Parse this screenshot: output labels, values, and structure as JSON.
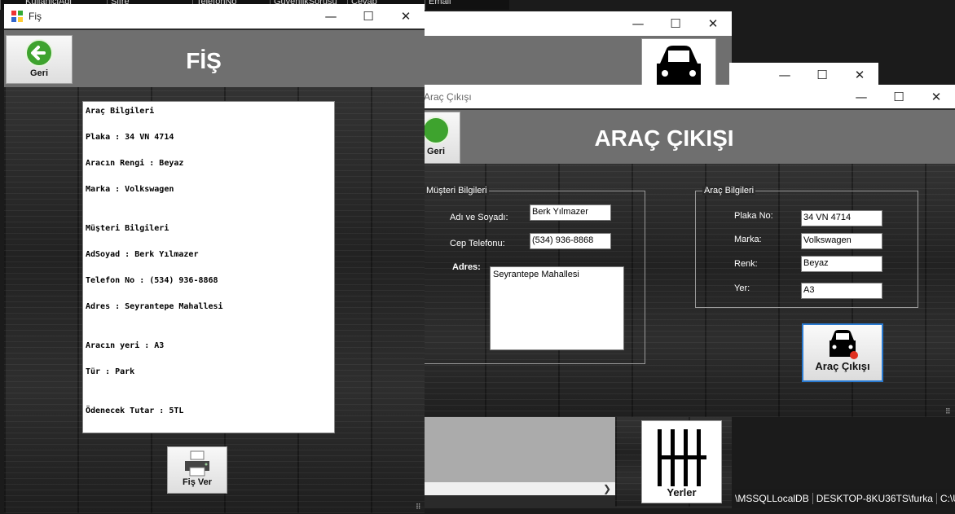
{
  "bg_table_headers": [
    "KullaniciAdi",
    "Sifre",
    "TelefonNo",
    "GuvenlikSorusu",
    "Cevap",
    "Email"
  ],
  "status_bar": {
    "db": "\\MSSQLLocalDB",
    "machine": "DESKTOP-8KU36TS\\furka",
    "path": "C:\\US"
  },
  "win_back": {
    "minimize": "—",
    "maximize": "☐",
    "close": "✕"
  },
  "yerler": {
    "label": "Yerler"
  },
  "fis": {
    "title": "Fiş",
    "header": "FİŞ",
    "back_label": "Geri",
    "print_label": "Fiş Ver",
    "minimize": "—",
    "maximize": "☐",
    "close": "✕",
    "receipt_lines": [
      "Araç Bilgileri",
      "Plaka : 34 VN 4714",
      "Aracın Rengi : Beyaz",
      "Marka : Volkswagen",
      "",
      "Müşteri Bilgileri",
      "AdSoyad : Berk Yılmazer",
      "Telefon No : (534) 936-8868",
      "Adres : Seyrantepe Mahallesi",
      "",
      "Aracın yeri : A3",
      "Tür : Park",
      "",
      "Ödenecek Tutar : 5TL"
    ]
  },
  "arac": {
    "title": "Araç Çıkışı",
    "header": "ARAÇ ÇIKIŞI",
    "back_label": "Geri",
    "minimize": "—",
    "maximize": "☐",
    "close": "✕",
    "musteri_group": "Müşteri Bilgileri",
    "adsoyad_label": "Adı ve Soyadı:",
    "adsoyad_value": "Berk Yılmazer",
    "telefon_label": "Cep Telefonu:",
    "telefon_value": "(534) 936-8868",
    "adres_label": "Adres:",
    "adres_value": "Seyrantepe Mahallesi",
    "arac_group": "Araç Bilgileri",
    "plaka_label": "Plaka No:",
    "plaka_value": "34 VN 4714",
    "marka_label": "Marka:",
    "marka_value": "Volkswagen",
    "renk_label": "Renk:",
    "renk_value": "Beyaz",
    "yer_label": "Yer:",
    "yer_value": "A3",
    "exit_button": "Araç Çıkışı"
  }
}
